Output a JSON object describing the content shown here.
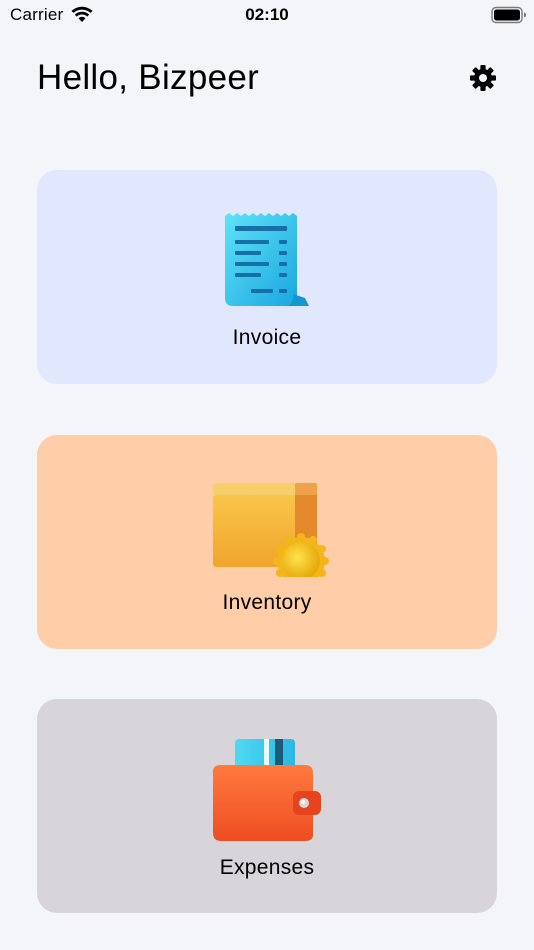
{
  "status_bar": {
    "carrier": "Carrier",
    "time": "02:10"
  },
  "header": {
    "greeting": "Hello, Bizpeer",
    "settings_icon": "gear-icon"
  },
  "cards": [
    {
      "label": "Invoice",
      "icon": "receipt-icon",
      "color": "#e1e8fd"
    },
    {
      "label": "Inventory",
      "icon": "box-icon",
      "color": "#ffcda8"
    },
    {
      "label": "Expenses",
      "icon": "wallet-icon",
      "color": "#d7d5da"
    }
  ]
}
